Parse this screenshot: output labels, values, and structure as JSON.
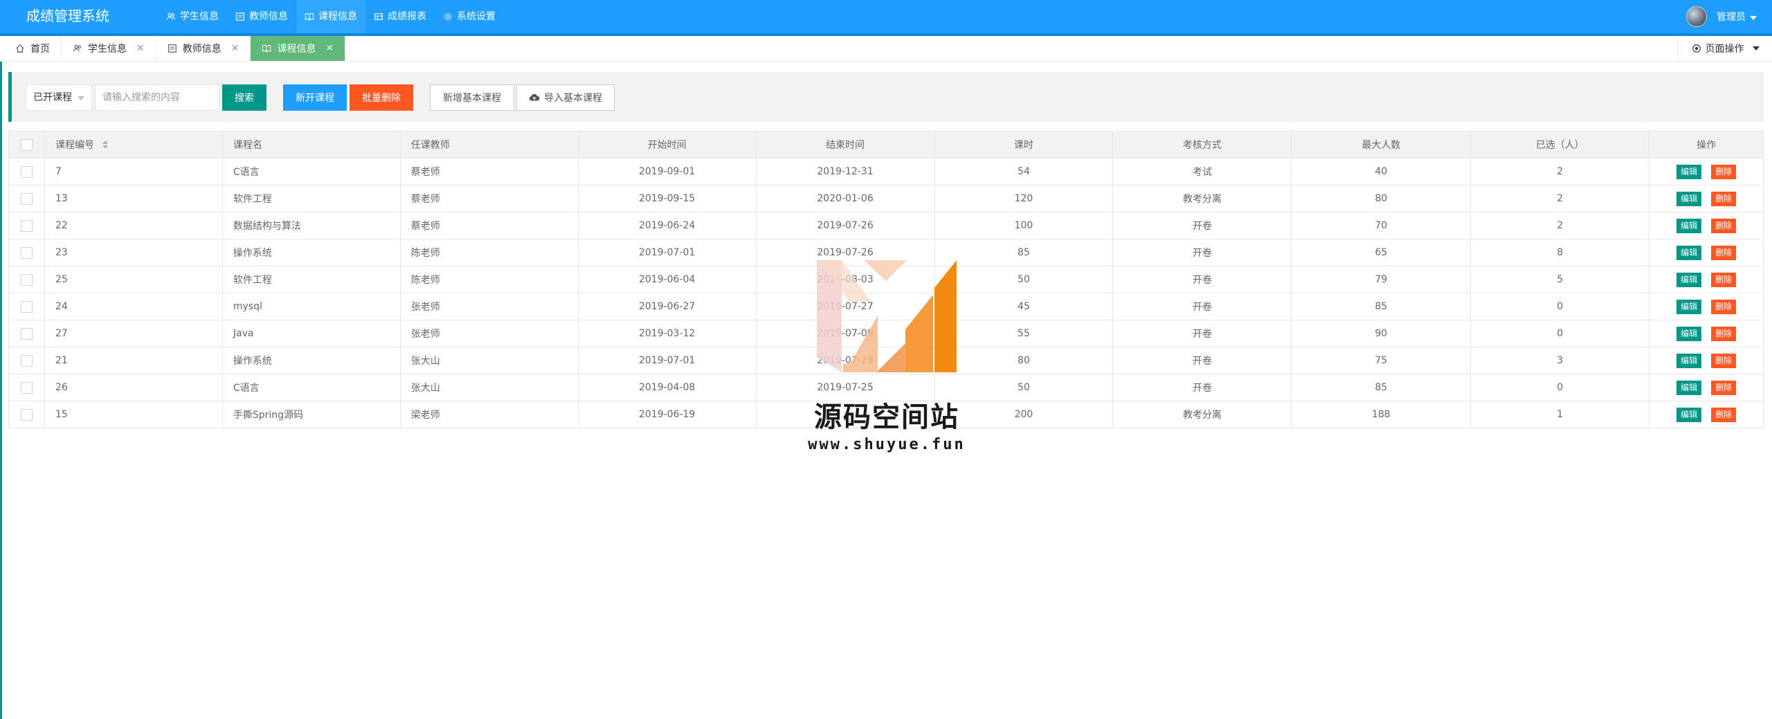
{
  "header": {
    "logo": "成绩管理系统",
    "nav": [
      {
        "label": "学生信息",
        "icon": "users-icon"
      },
      {
        "label": "教师信息",
        "icon": "id-card-icon"
      },
      {
        "label": "课程信息",
        "icon": "book-icon"
      },
      {
        "label": "成绩报表",
        "icon": "table-icon"
      },
      {
        "label": "系统设置",
        "icon": "gear-icon"
      }
    ],
    "user_label": "管理员"
  },
  "tabbar": {
    "tabs": [
      {
        "label": "首页",
        "icon": "home-icon"
      },
      {
        "label": "学生信息",
        "icon": "users-icon"
      },
      {
        "label": "教师信息",
        "icon": "id-card-icon"
      },
      {
        "label": "课程信息",
        "icon": "book-icon"
      }
    ],
    "close_symbol": "✕",
    "page_ops_label": "页面操作"
  },
  "toolbar": {
    "filter_value": "已开课程",
    "search_placeholder": "请输入搜索的内容",
    "search_label": "搜索",
    "new_course_label": "新开课程",
    "batch_delete_label": "批量删除",
    "add_basic_label": "新增基本课程",
    "import_basic_label": "导入基本课程"
  },
  "table": {
    "headers": [
      "课程编号",
      "课程名",
      "任课教师",
      "开始时间",
      "结束时间",
      "课时",
      "考核方式",
      "最大人数",
      "已选（人）",
      "操作"
    ],
    "edit_label": "编辑",
    "delete_label": "删除",
    "rows": [
      {
        "id": "7",
        "name": "C语言",
        "teacher": "蔡老师",
        "start": "2019-09-01",
        "end": "2019-12-31",
        "hours": "54",
        "exam": "考试",
        "max": "40",
        "selected": "2"
      },
      {
        "id": "13",
        "name": "软件工程",
        "teacher": "蔡老师",
        "start": "2019-09-15",
        "end": "2020-01-06",
        "hours": "120",
        "exam": "教考分离",
        "max": "80",
        "selected": "2"
      },
      {
        "id": "22",
        "name": "数据结构与算法",
        "teacher": "蔡老师",
        "start": "2019-06-24",
        "end": "2019-07-26",
        "hours": "100",
        "exam": "开卷",
        "max": "70",
        "selected": "2"
      },
      {
        "id": "23",
        "name": "操作系统",
        "teacher": "陈老师",
        "start": "2019-07-01",
        "end": "2019-07-26",
        "hours": "85",
        "exam": "开卷",
        "max": "65",
        "selected": "8"
      },
      {
        "id": "25",
        "name": "软件工程",
        "teacher": "陈老师",
        "start": "2019-06-04",
        "end": "2019-08-03",
        "hours": "50",
        "exam": "开卷",
        "max": "79",
        "selected": "5"
      },
      {
        "id": "24",
        "name": "mysql",
        "teacher": "张老师",
        "start": "2019-06-27",
        "end": "2019-07-27",
        "hours": "45",
        "exam": "开卷",
        "max": "85",
        "selected": "0"
      },
      {
        "id": "27",
        "name": "Java",
        "teacher": "张老师",
        "start": "2019-03-12",
        "end": "2019-07-09",
        "hours": "55",
        "exam": "开卷",
        "max": "90",
        "selected": "0"
      },
      {
        "id": "21",
        "name": "操作系统",
        "teacher": "张大山",
        "start": "2019-07-01",
        "end": "2019-07-29",
        "hours": "80",
        "exam": "开卷",
        "max": "75",
        "selected": "3"
      },
      {
        "id": "26",
        "name": "C语言",
        "teacher": "张大山",
        "start": "2019-04-08",
        "end": "2019-07-25",
        "hours": "50",
        "exam": "开卷",
        "max": "85",
        "selected": "0"
      },
      {
        "id": "15",
        "name": "手撕Spring源码",
        "teacher": "梁老师",
        "start": "2019-06-19",
        "end": "",
        "hours": "200",
        "exam": "教考分离",
        "max": "188",
        "selected": "1"
      }
    ]
  },
  "watermark": {
    "title": "源码空间站",
    "url": "www.shuyue.fun"
  },
  "colors": {
    "header_bg": "#1E9FFF",
    "accent_teal": "#009688",
    "active_tab": "#5FB878",
    "danger": "#FF5722"
  }
}
